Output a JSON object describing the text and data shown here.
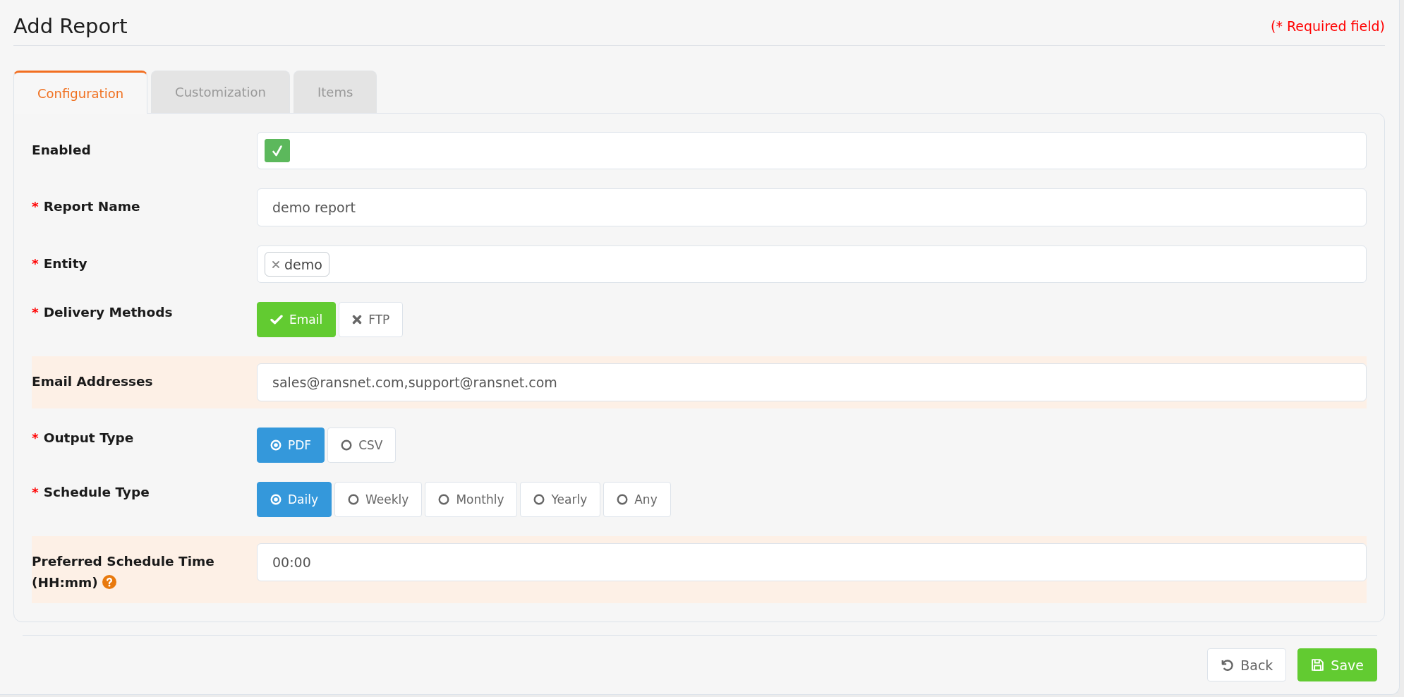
{
  "page": {
    "title": "Add Report",
    "required_note": "(* Required field)"
  },
  "tabs": [
    {
      "label": "Configuration",
      "selected": true
    },
    {
      "label": "Customization",
      "selected": false
    },
    {
      "label": "Items",
      "selected": false
    }
  ],
  "form": {
    "rows": [
      {
        "kind": "checkbox",
        "label": "Enabled",
        "highlighted": false,
        "help": false,
        "checked": true
      },
      {
        "kind": "text",
        "required_mark": "*",
        "label": "Report Name",
        "highlighted": false,
        "help": false,
        "value": "demo report"
      },
      {
        "kind": "tags",
        "required_mark": "*",
        "label": "Entity",
        "highlighted": false,
        "help": false,
        "tags": [
          "demo"
        ]
      },
      {
        "kind": "toggles",
        "required_mark": "*",
        "label": "Delivery Methods",
        "highlighted": false,
        "help": false,
        "options": [
          {
            "label": "Email",
            "selected": true
          },
          {
            "label": "FTP",
            "selected": false
          }
        ]
      },
      {
        "kind": "text",
        "label": "Email Addresses",
        "highlighted": true,
        "help": false,
        "value": "sales@ransnet.com,support@ransnet.com"
      },
      {
        "kind": "radios",
        "required_mark": "*",
        "label": "Output Type",
        "highlighted": false,
        "help": false,
        "options": [
          {
            "label": "PDF",
            "selected": true
          },
          {
            "label": "CSV",
            "selected": false
          }
        ]
      },
      {
        "kind": "radios",
        "required_mark": "*",
        "label": "Schedule Type",
        "highlighted": false,
        "help": false,
        "options": [
          {
            "label": "Daily",
            "selected": true
          },
          {
            "label": "Weekly",
            "selected": false
          },
          {
            "label": "Monthly",
            "selected": false
          },
          {
            "label": "Yearly",
            "selected": false
          },
          {
            "label": "Any",
            "selected": false
          }
        ]
      },
      {
        "kind": "text",
        "label": "Preferred Schedule Time",
        "hint": "(HH:mm)",
        "highlighted": true,
        "help": true,
        "value": "00:00"
      }
    ]
  },
  "actions": [
    {
      "kind": "back",
      "label": "Back"
    },
    {
      "kind": "save",
      "label": "Save"
    }
  ]
}
